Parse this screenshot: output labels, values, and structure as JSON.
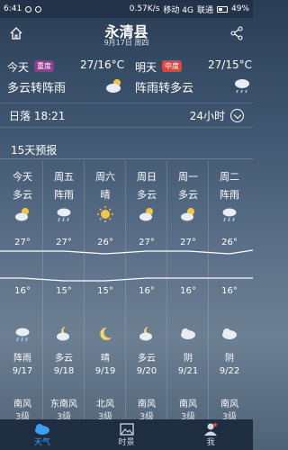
{
  "status": {
    "time": "6:41",
    "speed": "0.57K/s",
    "network": "移动 4G",
    "carrier": "联通",
    "battery": "49%"
  },
  "header": {
    "city": "永清县",
    "date": "9月17日 周四"
  },
  "today": {
    "label": "今天",
    "aqi": "重度",
    "aqi_color": "#8e3c8e",
    "temp": "27/16°C",
    "cond": "多云转阵雨"
  },
  "tomorrow": {
    "label": "明天",
    "aqi": "中度",
    "aqi_color": "#e0453a",
    "temp": "27/15°C",
    "cond": "阵雨转多云"
  },
  "sunset": {
    "label": "日落 18:21",
    "hours": "24小时"
  },
  "forecast": {
    "title": "15天预报",
    "days": [
      {
        "name": "今天",
        "cond": "多云",
        "day_icon": "cloud-sun-icon",
        "hi": "27°",
        "lo": "16°",
        "night_icon": "rain-icon",
        "night_cond": "阵雨",
        "date": "9/17",
        "wind": "南风",
        "level": "3级"
      },
      {
        "name": "周五",
        "cond": "阵雨",
        "day_icon": "rain-cloud-icon",
        "hi": "27°",
        "lo": "15°",
        "night_icon": "cloud-moon-icon",
        "night_cond": "多云",
        "date": "9/18",
        "wind": "东南风",
        "level": "3级"
      },
      {
        "name": "周六",
        "cond": "晴",
        "day_icon": "sun-icon",
        "hi": "26°",
        "lo": "15°",
        "night_icon": "moon-icon",
        "night_cond": "晴",
        "date": "9/19",
        "wind": "北风",
        "level": "3级"
      },
      {
        "name": "周日",
        "cond": "多云",
        "day_icon": "cloud-sun-icon",
        "hi": "27°",
        "lo": "16°",
        "night_icon": "cloud-moon-icon",
        "night_cond": "多云",
        "date": "9/20",
        "wind": "南风",
        "level": "3级"
      },
      {
        "name": "周一",
        "cond": "多云",
        "day_icon": "cloud-sun-icon",
        "hi": "27°",
        "lo": "16°",
        "night_icon": "cloud-icon",
        "night_cond": "阴",
        "date": "9/21",
        "wind": "南风",
        "level": "3级"
      },
      {
        "name": "周二",
        "cond": "阵雨",
        "day_icon": "rain-cloud-icon",
        "hi": "26°",
        "lo": "16°",
        "night_icon": "cloud-icon",
        "night_cond": "阴",
        "date": "9/22",
        "wind": "南风",
        "level": "3级"
      }
    ]
  },
  "tabs": [
    {
      "label": "天气",
      "icon": "weather-tab-icon",
      "active": true
    },
    {
      "label": "时景",
      "icon": "photo-tab-icon",
      "active": false
    },
    {
      "label": "我",
      "icon": "profile-tab-icon",
      "active": false
    }
  ]
}
